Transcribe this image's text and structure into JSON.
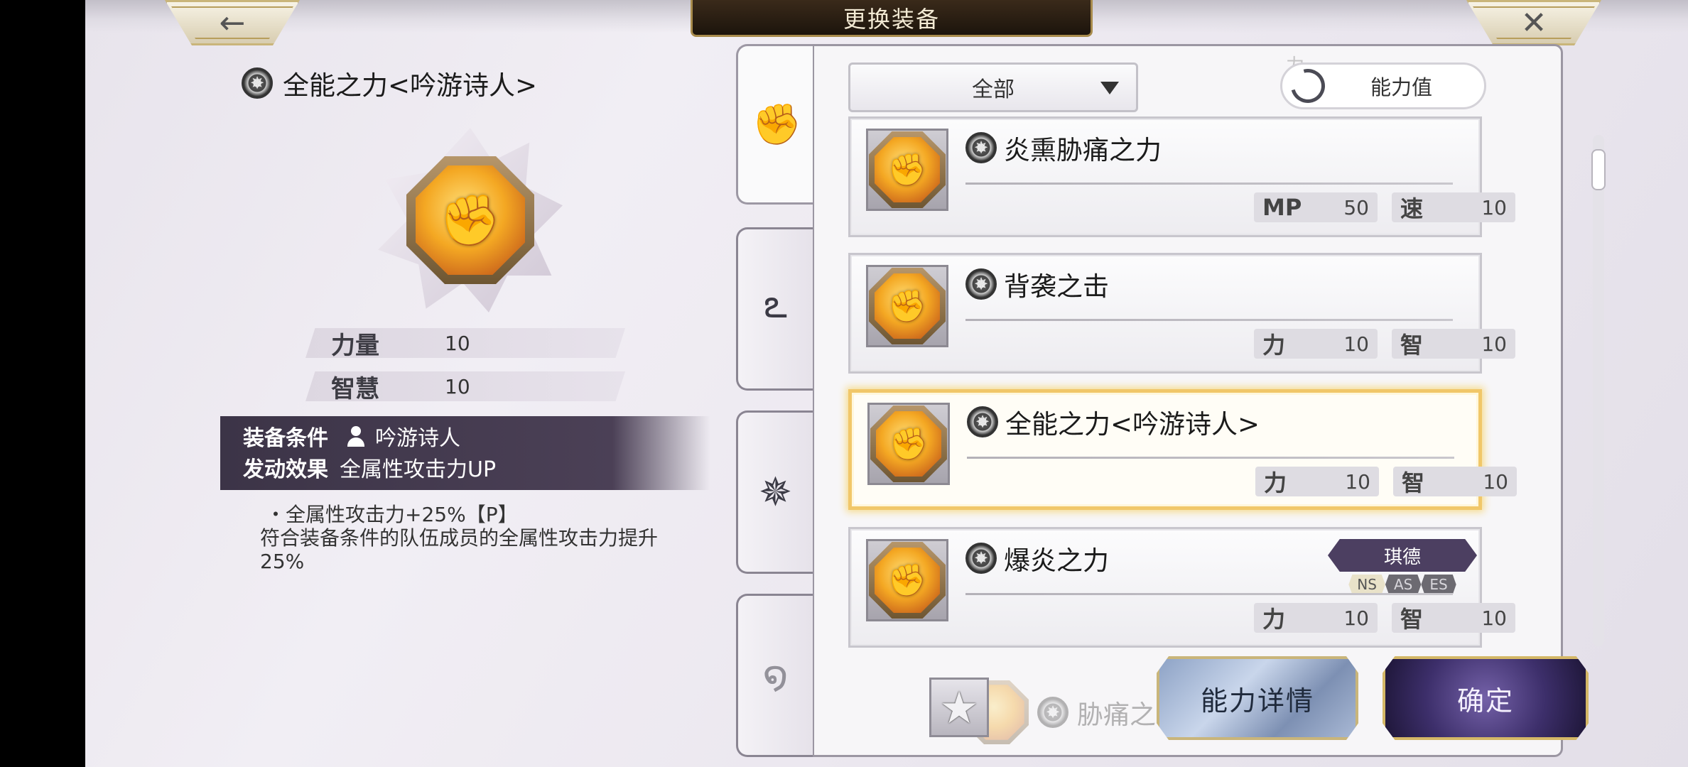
{
  "header": {
    "title": "更换装备",
    "back_icon": "←",
    "close_icon": "✕"
  },
  "detail": {
    "name": "全能之力<吟游诗人>",
    "stats": [
      {
        "label": "力量",
        "value": "10"
      },
      {
        "label": "智慧",
        "value": "10"
      }
    ],
    "condition_label": "装备条件",
    "condition_value": "吟游诗人",
    "effect_label": "发动效果",
    "effect_value": "全属性攻击力UP",
    "description_line1": "・全属性攻击力+25%【P】",
    "description_line2": "符合装备条件的队伍成员的全属性攻击力提升25%"
  },
  "tabs": [
    {
      "icon": "fist-icon",
      "glyph": "✊"
    },
    {
      "icon": "wind-swirl-icon",
      "glyph": "ఽ"
    },
    {
      "icon": "rune-icon",
      "glyph": "✵"
    },
    {
      "icon": "spiral-icon",
      "glyph": "໑"
    }
  ],
  "filter": {
    "selected": "全部"
  },
  "sort": {
    "label": "能力值"
  },
  "ghost_top": "力",
  "items": [
    {
      "name": "炎熏胁痛之力",
      "stats": [
        {
          "k": "MP",
          "v": "50"
        },
        {
          "k": "速",
          "v": "10"
        }
      ]
    },
    {
      "name": "背袭之击",
      "stats": [
        {
          "k": "力",
          "v": "10"
        },
        {
          "k": "智",
          "v": "10"
        }
      ]
    },
    {
      "name": "全能之力<吟游诗人>",
      "stats": [
        {
          "k": "力",
          "v": "10"
        },
        {
          "k": "智",
          "v": "10"
        }
      ],
      "selected": true
    },
    {
      "name": "爆炎之力",
      "stats": [
        {
          "k": "力",
          "v": "10"
        },
        {
          "k": "智",
          "v": "10"
        }
      ],
      "tag": {
        "name": "琪德",
        "cats": [
          "NS",
          "AS",
          "ES"
        ]
      }
    }
  ],
  "ghost_item": {
    "name": "胁痛之"
  },
  "buttons": {
    "detail": "能力详情",
    "confirm": "确定",
    "favorite_icon": "★"
  }
}
